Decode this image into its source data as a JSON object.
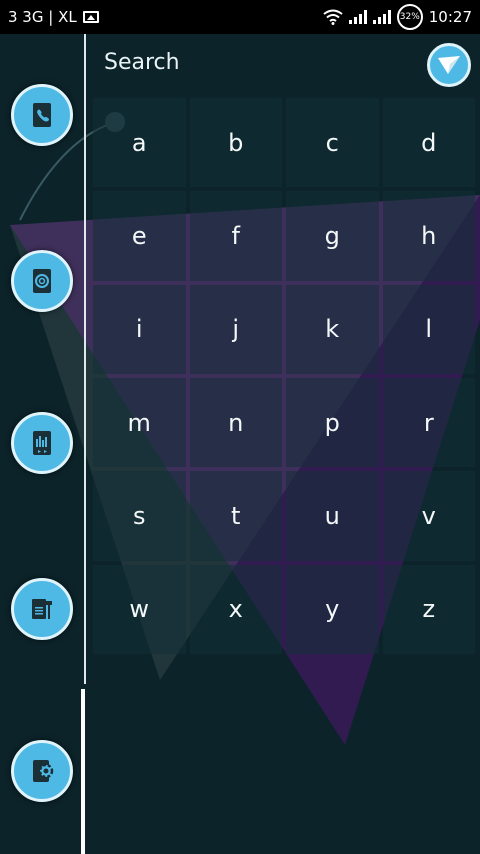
{
  "status_bar": {
    "carrier": "3 3G | XL",
    "battery_percent": "32%",
    "time": "10:27"
  },
  "header": {
    "search_label": "Search"
  },
  "dock": {
    "items": [
      {
        "icon": "phone-icon"
      },
      {
        "icon": "email-icon"
      },
      {
        "icon": "media-player-icon"
      },
      {
        "icon": "tools-icon"
      },
      {
        "icon": "settings-icon"
      }
    ]
  },
  "telegram_button": {
    "icon": "paper-plane-icon"
  },
  "letters": [
    "a",
    "b",
    "c",
    "d",
    "e",
    "f",
    "g",
    "h",
    "i",
    "j",
    "k",
    "l",
    "m",
    "n",
    "p",
    "r",
    "s",
    "t",
    "u",
    "v",
    "w",
    "x",
    "y",
    "z"
  ],
  "colors": {
    "background": "#0b2329",
    "accent_blue": "#4fb9e6",
    "purple_overlay": "#4a1f6b",
    "key_tile": "#14303a"
  }
}
